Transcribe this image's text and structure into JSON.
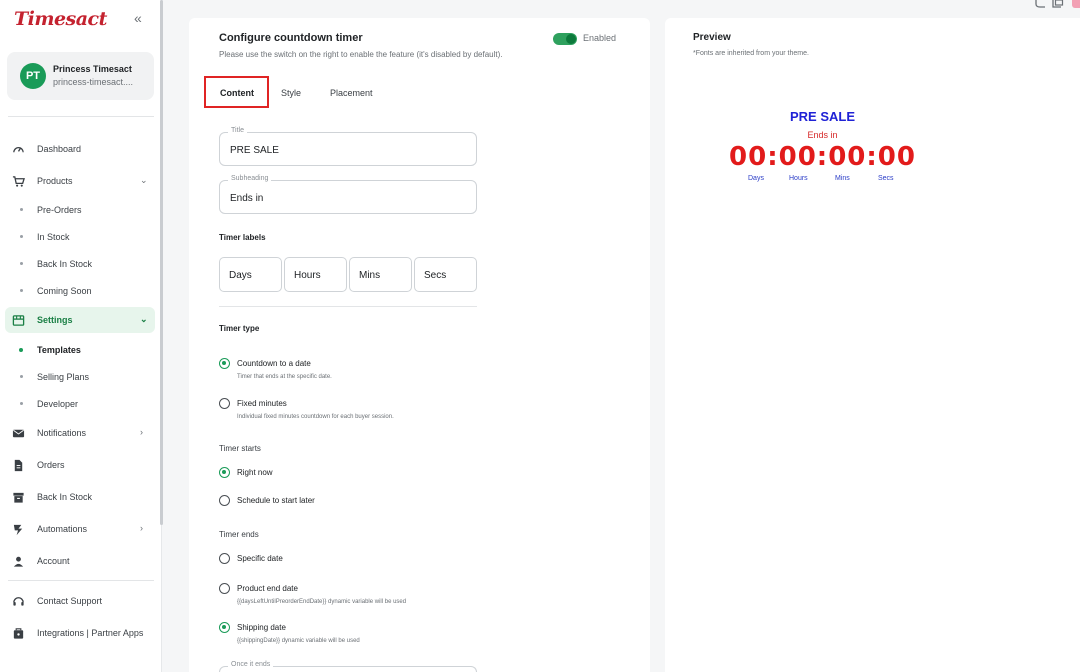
{
  "app": {
    "logo": "Timesact",
    "collapse_icon": "«"
  },
  "profile": {
    "initials": "PT",
    "name": "Princess Timesact",
    "store": "princess-timesact...."
  },
  "nav": {
    "dashboard": "Dashboard",
    "products": "Products",
    "pre_orders": "Pre-Orders",
    "in_stock": "In Stock",
    "back_in_stock_sub": "Back In Stock",
    "coming_soon": "Coming Soon",
    "settings": "Settings",
    "templates": "Templates",
    "selling_plans": "Selling Plans",
    "developer": "Developer",
    "notifications": "Notifications",
    "orders": "Orders",
    "back_in_stock": "Back In Stock",
    "automations": "Automations",
    "account": "Account",
    "contact_support": "Contact Support",
    "integrations": "Integrations | Partner Apps",
    "chev_down": "⌄",
    "chev_right": "›"
  },
  "form": {
    "title": "Configure countdown timer",
    "subtitle": "Please use the switch on the right to enable the feature (it's disabled by default).",
    "toggle_label": "Enabled",
    "tabs": {
      "content": "Content",
      "style": "Style",
      "placement": "Placement"
    },
    "title_field": {
      "legend": "Title",
      "value": "PRE SALE"
    },
    "subheading_field": {
      "legend": "Subheading",
      "value": "Ends in"
    },
    "timer_labels_heading": "Timer labels",
    "timer_labels": {
      "days": "Days",
      "hours": "Hours",
      "mins": "Mins",
      "secs": "Secs"
    },
    "timer_type_heading": "Timer type",
    "timer_type": {
      "countdown": {
        "label": "Countdown to a date",
        "help": "Timer that ends at the specific date."
      },
      "fixed": {
        "label": "Fixed minutes",
        "help": "Individual fixed minutes countdown for each buyer session."
      }
    },
    "timer_starts_heading": "Timer starts",
    "timer_starts": {
      "now": "Right now",
      "later": "Schedule to start later"
    },
    "timer_ends_heading": "Timer ends",
    "timer_ends": {
      "specific": "Specific date",
      "product_end": {
        "label": "Product end date",
        "help": "{{daysLeftUntilPreorderEndDate}} dynamic variable will be used"
      },
      "shipping": {
        "label": "Shipping date",
        "help": "{{shippingDate}} dynamic variable will be used"
      }
    },
    "once_ends_legend": "Once it ends"
  },
  "preview": {
    "title": "Preview",
    "note": "*Fonts are inherited from your theme.",
    "heading": "PRE SALE",
    "subheading": "Ends in",
    "clock": "00:00:00:00",
    "units": {
      "days": "Days",
      "hours": "Hours",
      "mins": "Mins",
      "secs": "Secs"
    },
    "colors": {
      "heading": "#1f22d6",
      "subheading": "#d62828",
      "clock": "#e21b1b",
      "units": "#2a3cc7"
    }
  }
}
